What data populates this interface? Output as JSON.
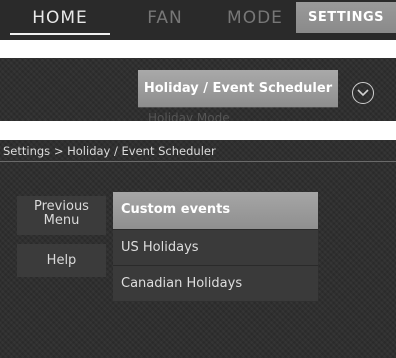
{
  "tabbar": {
    "tabs": [
      {
        "label": "HOME"
      },
      {
        "label": "FAN"
      },
      {
        "label": "MODE"
      },
      {
        "label": "SETTINGS"
      }
    ]
  },
  "scheduler_strip": {
    "selected_label": "Holiday / Event Scheduler",
    "next_label": "Holiday Mode",
    "expand_icon": "chevron-down-circle-icon"
  },
  "settings_screen": {
    "breadcrumb": "Settings > Holiday / Event Scheduler",
    "previous_menu_label": "Previous Menu",
    "help_label": "Help",
    "items": [
      {
        "label": "Custom events"
      },
      {
        "label": "US Holidays"
      },
      {
        "label": "Canadian Holidays"
      }
    ]
  },
  "colors": {
    "background": "#2c2c2c",
    "selected": "#999999",
    "text": "#dedede"
  }
}
